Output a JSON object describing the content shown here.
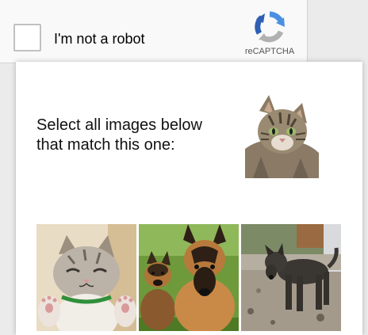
{
  "anchor": {
    "checkbox_label": "I'm not a robot",
    "brand_text": "reCAPTCHA",
    "brand_icon": "recaptcha-logo-icon"
  },
  "challenge": {
    "prompt": "Select all images below that match this one:",
    "sample_image": "cat-photo",
    "tiles": [
      {
        "image": "kitten-photo"
      },
      {
        "image": "german-shepherd-dogs-photo"
      },
      {
        "image": "dark-dog-photo"
      }
    ]
  },
  "colors": {
    "logo_blue": "#4a90e2",
    "logo_gray": "#b1b1b1",
    "checkbox_border": "#c1c1c1"
  }
}
